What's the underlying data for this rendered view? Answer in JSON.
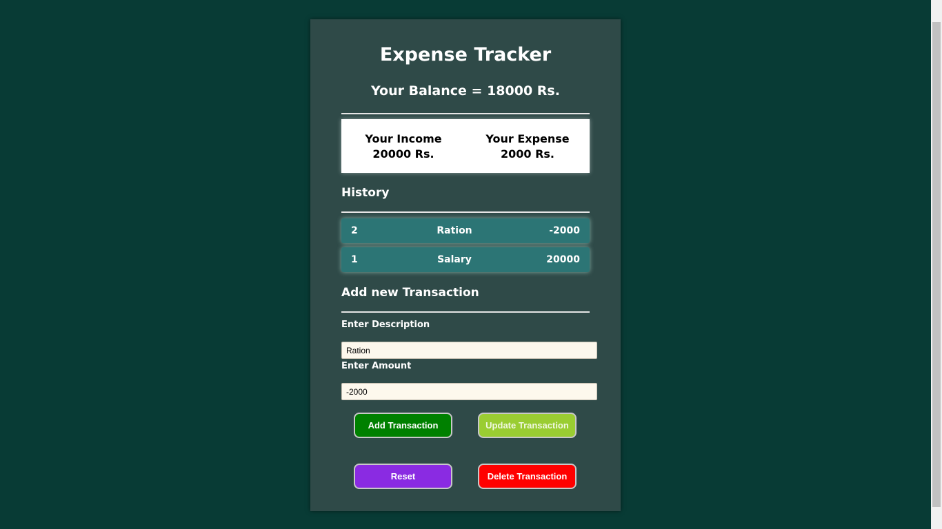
{
  "app": {
    "title": "Expense Tracker",
    "balance_text": "Your Balance = 18000 Rs."
  },
  "summary": {
    "income_label": "Your Income",
    "income_value": "20000 Rs.",
    "expense_label": "Your Expense",
    "expense_value": "2000 Rs."
  },
  "history": {
    "heading": "History",
    "items": [
      {
        "id": "2",
        "description": "Ration",
        "amount": "-2000"
      },
      {
        "id": "1",
        "description": "Salary",
        "amount": "20000"
      }
    ]
  },
  "form": {
    "heading": "Add new Transaction",
    "description_label": "Enter Description",
    "description_value": "Ration",
    "amount_label": "Enter Amount",
    "amount_value": "-2000"
  },
  "buttons": {
    "add": "Add Transaction",
    "update": "Update Transaction",
    "reset": "Reset",
    "delete": "Delete Transaction"
  },
  "colors": {
    "page_bg": "#083b35",
    "card_bg": "#2f4a48",
    "history_row": "#2c7575",
    "add": "#008000",
    "update": "#9acd32",
    "reset": "#8a2be2",
    "delete": "#ff0000"
  }
}
